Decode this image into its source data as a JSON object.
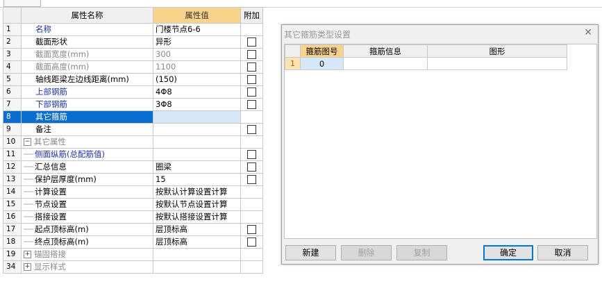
{
  "tab": {
    "label": ""
  },
  "grid": {
    "headers": {
      "name": "属性名称",
      "value": "属性值",
      "extra": "附加"
    },
    "rows": [
      {
        "num": "1",
        "name": "名称",
        "value": "门楼节点6-6",
        "style": "blue"
      },
      {
        "num": "2",
        "name": "截面形状",
        "value": "异形",
        "check": true
      },
      {
        "num": "3",
        "name": "截面宽度(mm)",
        "value": "300",
        "style": "gray",
        "valgray": true,
        "check": true
      },
      {
        "num": "4",
        "name": "截面高度(mm)",
        "value": "1100",
        "style": "gray",
        "valgray": true,
        "check": true
      },
      {
        "num": "5",
        "name": "轴线距梁左边线距离(mm)",
        "value": "(150)",
        "check": true
      },
      {
        "num": "6",
        "name": "上部钢筋",
        "value": "4Φ8",
        "style": "blue",
        "check": true
      },
      {
        "num": "7",
        "name": "下部钢筋",
        "value": "3Φ8",
        "style": "blue",
        "check": true
      },
      {
        "num": "8",
        "name": "其它箍筋",
        "value": "",
        "selected": true
      },
      {
        "num": "9",
        "name": "备注",
        "value": "",
        "check": true
      },
      {
        "num": "10",
        "name": "其它属性",
        "value": "",
        "style": "gray",
        "expander": "−"
      },
      {
        "num": "11",
        "name": "侧面纵筋(总配筋值)",
        "value": "",
        "style": "blue",
        "tree": true,
        "check": true
      },
      {
        "num": "12",
        "name": "汇总信息",
        "value": "圈梁",
        "tree": true,
        "check": true
      },
      {
        "num": "13",
        "name": "保护层厚度(mm)",
        "value": "15",
        "tree": true,
        "check": true
      },
      {
        "num": "14",
        "name": "计算设置",
        "value": "按默认计算设置计算",
        "tree": true
      },
      {
        "num": "15",
        "name": "节点设置",
        "value": "按默认节点设置计算",
        "tree": true
      },
      {
        "num": "16",
        "name": "搭接设置",
        "value": "按默认搭接设置计算",
        "tree": true
      },
      {
        "num": "17",
        "name": "起点顶标高(m)",
        "value": "层顶标高",
        "tree": true,
        "check": true
      },
      {
        "num": "18",
        "name": "终点顶标高(m)",
        "value": "层顶标高",
        "tree": true,
        "check": true
      },
      {
        "num": "19",
        "name": "锚固搭接",
        "value": "",
        "style": "gray",
        "expander": "+"
      },
      {
        "num": "34",
        "name": "显示样式",
        "value": "",
        "style": "gray",
        "expander": "+"
      }
    ]
  },
  "dialog": {
    "title": "其它箍筋类型设置",
    "close": "✕",
    "table": {
      "headers": [
        "箍筋图号",
        "箍筋信息",
        "图形"
      ],
      "rows": [
        {
          "num": "1",
          "code": "0",
          "info": "",
          "shape": ""
        }
      ]
    },
    "buttons": {
      "new": "新建",
      "delete": "删除",
      "copy": "复制",
      "ok": "确定",
      "cancel": "取消"
    }
  },
  "colors": {
    "header_highlight": "#f9d38a",
    "selection": "#0a6ed1",
    "link_blue": "#1a2fb5"
  }
}
